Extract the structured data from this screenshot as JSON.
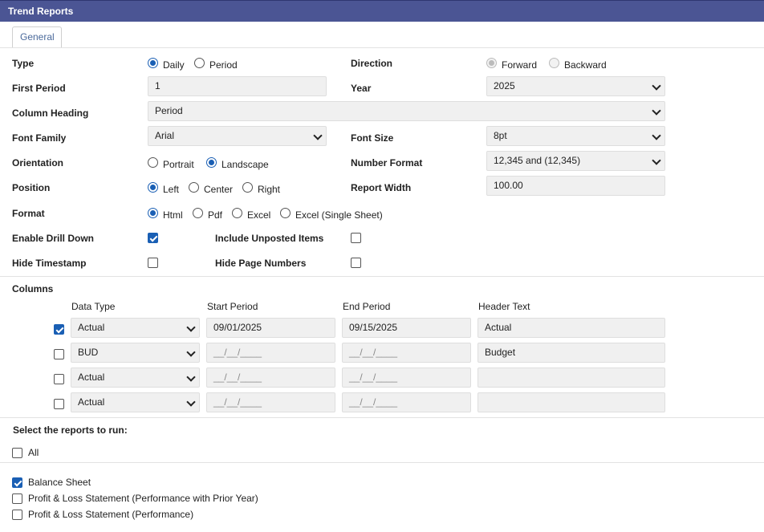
{
  "window": {
    "title": "Trend Reports"
  },
  "tabs": [
    {
      "label": "General"
    }
  ],
  "type": {
    "label": "Type",
    "options": [
      "Daily",
      "Period"
    ],
    "selected": "Daily"
  },
  "direction": {
    "label": "Direction",
    "options": [
      "Forward",
      "Backward"
    ],
    "selected": "Forward"
  },
  "first_period": {
    "label": "First Period",
    "value": "1"
  },
  "year": {
    "label": "Year",
    "value": "2025"
  },
  "column_heading": {
    "label": "Column Heading",
    "value": "Period"
  },
  "font_family": {
    "label": "Font Family",
    "value": "Arial"
  },
  "font_size": {
    "label": "Font Size",
    "value": "8pt"
  },
  "orientation": {
    "label": "Orientation",
    "options": [
      "Portrait",
      "Landscape"
    ],
    "selected": "Landscape"
  },
  "number_format": {
    "label": "Number Format",
    "value": "12,345 and (12,345)"
  },
  "position": {
    "label": "Position",
    "options": [
      "Left",
      "Center",
      "Right"
    ],
    "selected": "Left"
  },
  "report_width": {
    "label": "Report Width",
    "value": "100.00"
  },
  "format": {
    "label": "Format",
    "options": [
      "Html",
      "Pdf",
      "Excel",
      "Excel (Single Sheet)"
    ],
    "selected": "Html"
  },
  "enable_drill_down": {
    "label": "Enable Drill Down",
    "checked": true
  },
  "include_unposted": {
    "label": "Include Unposted Items",
    "checked": false
  },
  "hide_timestamp": {
    "label": "Hide Timestamp",
    "checked": false
  },
  "hide_page_numbers": {
    "label": "Hide Page Numbers",
    "checked": false
  },
  "columns": {
    "label": "Columns",
    "headers": [
      "Data Type",
      "Start Period",
      "End Period",
      "Header Text"
    ],
    "rows": [
      {
        "checked": true,
        "data_type": "Actual",
        "start": "09/01/2025",
        "end": "09/15/2025",
        "header": "Actual"
      },
      {
        "checked": false,
        "data_type": "BUD",
        "start": "__/__/____",
        "end": "__/__/____",
        "header": "Budget"
      },
      {
        "checked": false,
        "data_type": "Actual",
        "start": "__/__/____",
        "end": "__/__/____",
        "header": ""
      },
      {
        "checked": false,
        "data_type": "Actual",
        "start": "__/__/____",
        "end": "__/__/____",
        "header": ""
      }
    ]
  },
  "reports": {
    "label": "Select the reports to run:",
    "all_label": "All",
    "items": [
      {
        "label": "Balance Sheet",
        "checked": true
      },
      {
        "label": "Profit & Loss Statement (Performance with Prior Year)",
        "checked": false
      },
      {
        "label": "Profit & Loss Statement (Performance)",
        "checked": false
      }
    ]
  }
}
